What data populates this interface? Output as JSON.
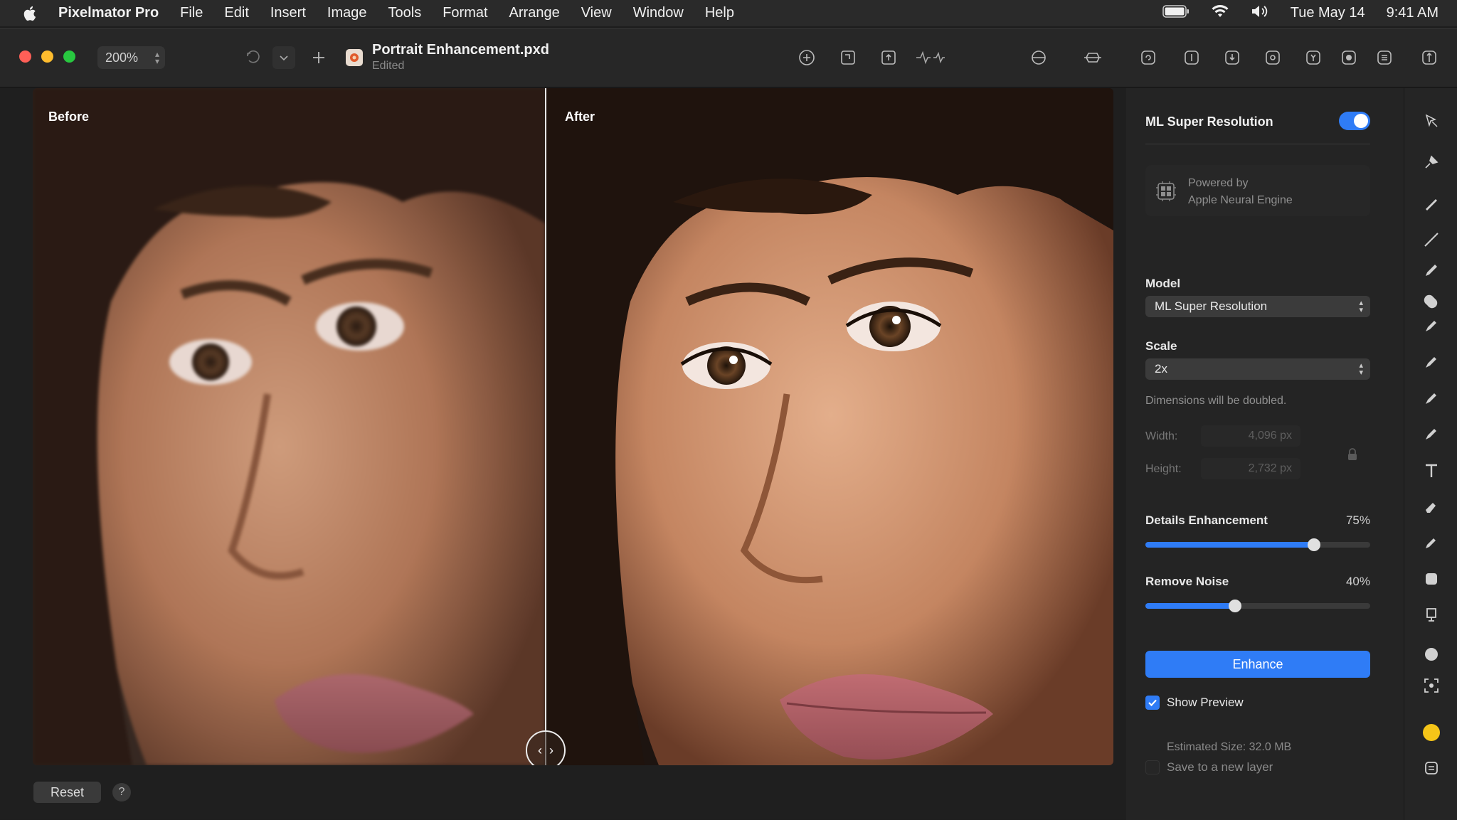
{
  "menubar": {
    "app_name": "Pixelmator Pro",
    "menus": [
      "File",
      "Edit",
      "Insert",
      "Image",
      "Tools",
      "Format",
      "Arrange",
      "View",
      "Window",
      "Help"
    ],
    "date": "Tue May 14",
    "time": "9:41 AM"
  },
  "toolbar": {
    "zoom": "200%",
    "document_title": "Portrait Enhancement.pxd",
    "document_status": "Edited"
  },
  "canvas": {
    "before_label": "Before",
    "after_label": "After"
  },
  "footer": {
    "reset_label": "Reset",
    "help_label": "?"
  },
  "inspector": {
    "title": "ML Super Resolution",
    "enabled": true,
    "engine_line1": "Powered by",
    "engine_line2": "Apple Neural Engine",
    "model_label": "Model",
    "model_value": "ML Super Resolution",
    "scale_label": "Scale",
    "scale_value": "2x",
    "scale_hint": "Dimensions will be doubled.",
    "width_label": "Width:",
    "width_value": "4,096 px",
    "height_label": "Height:",
    "height_value": "2,732 px",
    "details_label": "Details Enhancement",
    "details_value": "75%",
    "details_level": 0.75,
    "noise_label": "Remove Noise",
    "noise_value": "40%",
    "noise_level": 0.4,
    "enhance_label": "Enhance",
    "show_preview_label": "Show Preview",
    "show_preview_checked": true,
    "estimated_size": "Estimated Size: 32.0 MB",
    "save_new_layer_label": "Save to a new layer",
    "save_new_layer_checked": false
  },
  "colors": {
    "accent": "#2f7cf6",
    "traffic_red": "#ff5f57",
    "traffic_yellow": "#febc2e",
    "traffic_green": "#28c840",
    "color_well": "#f5c518"
  }
}
